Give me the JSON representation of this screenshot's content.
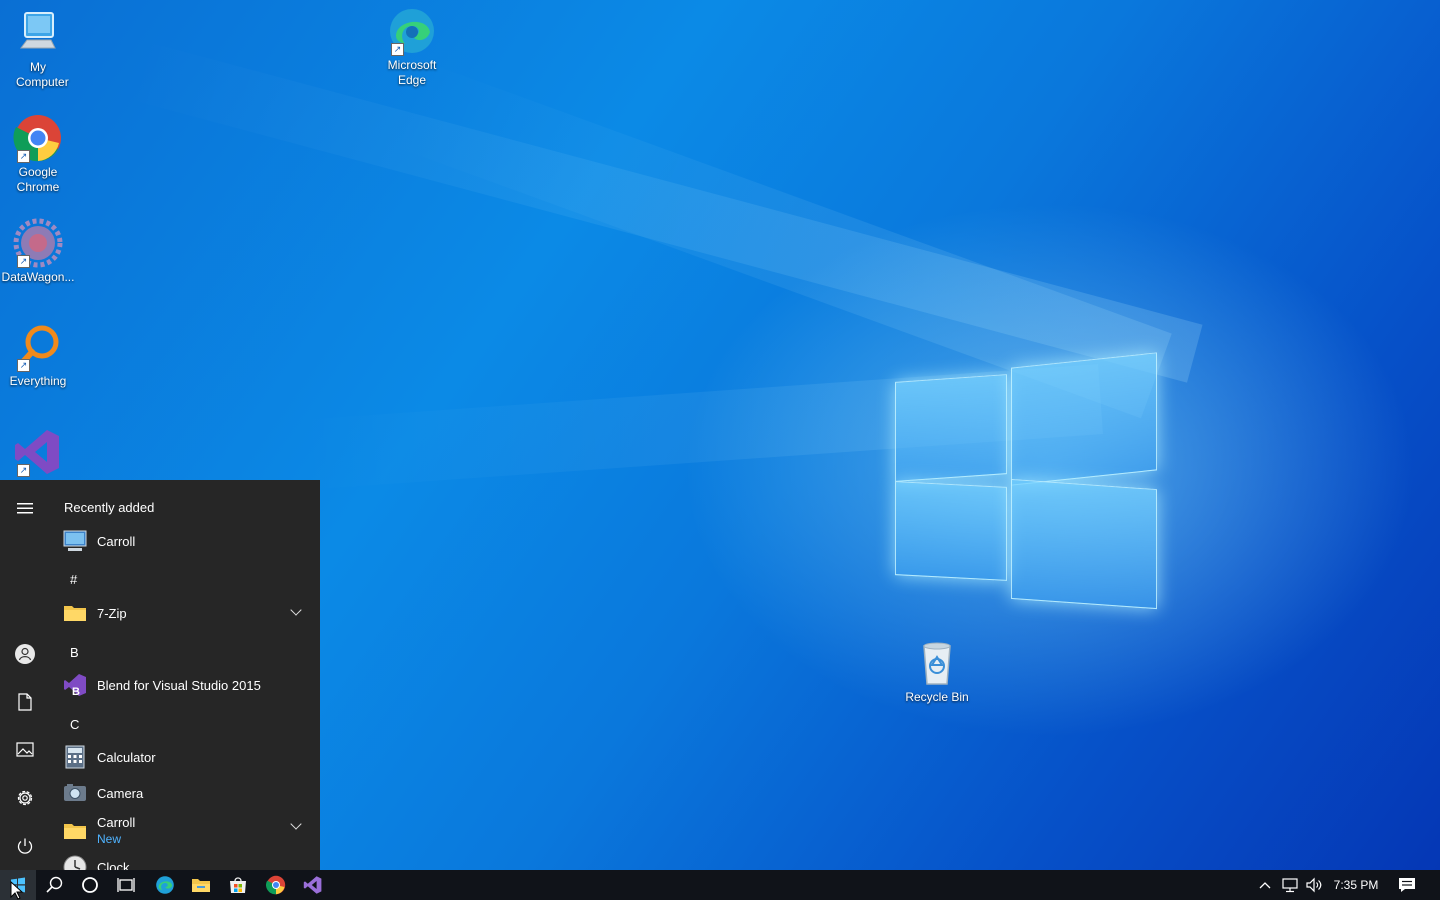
{
  "desktop": {
    "icons": [
      {
        "label": "My Computer",
        "icon": "computer-icon"
      },
      {
        "label": "Microsoft Edge",
        "icon": "edge-icon"
      },
      {
        "label": "Google Chrome",
        "icon": "chrome-icon"
      },
      {
        "label": "DataWagon...",
        "icon": "datawagon-icon"
      },
      {
        "label": "Everything",
        "icon": "everything-icon"
      },
      {
        "label": "",
        "icon": "visual-studio-icon"
      },
      {
        "label": "Recycle Bin",
        "icon": "recycle-bin-icon"
      }
    ]
  },
  "start_menu": {
    "recently_added_header": "Recently added",
    "items": [
      {
        "label": "Carroll",
        "icon": "computer-monitor-icon"
      },
      {
        "letter": "#"
      },
      {
        "label": "7-Zip",
        "icon": "folder-icon",
        "expandable": true
      },
      {
        "letter": "B"
      },
      {
        "label": "Blend for Visual Studio 2015",
        "icon": "blend-icon"
      },
      {
        "letter": "C"
      },
      {
        "label": "Calculator",
        "icon": "calculator-icon"
      },
      {
        "label": "Camera",
        "icon": "camera-icon"
      },
      {
        "label": "Carroll",
        "sublabel": "New",
        "icon": "folder-icon",
        "expandable": true
      },
      {
        "label": "Clock",
        "icon": "clock-icon"
      }
    ],
    "rail": [
      "hamburger-menu-icon",
      "user-icon",
      "documents-icon",
      "pictures-icon",
      "settings-icon",
      "power-icon"
    ]
  },
  "taskbar": {
    "clock": "7:35 PM",
    "buttons": [
      "start-icon",
      "search-icon",
      "cortana-icon",
      "task-view-icon",
      "edge-icon",
      "file-explorer-icon",
      "store-icon",
      "chrome-icon",
      "visual-studio-icon"
    ],
    "tray": [
      "chevron-up-icon",
      "network-icon",
      "volume-icon",
      "notifications-icon"
    ]
  },
  "colors": {
    "start_bg": "#262626",
    "taskbar_bg": "#101319",
    "accent": "#4cc2ff",
    "new_badge": "#4fb3ff"
  }
}
